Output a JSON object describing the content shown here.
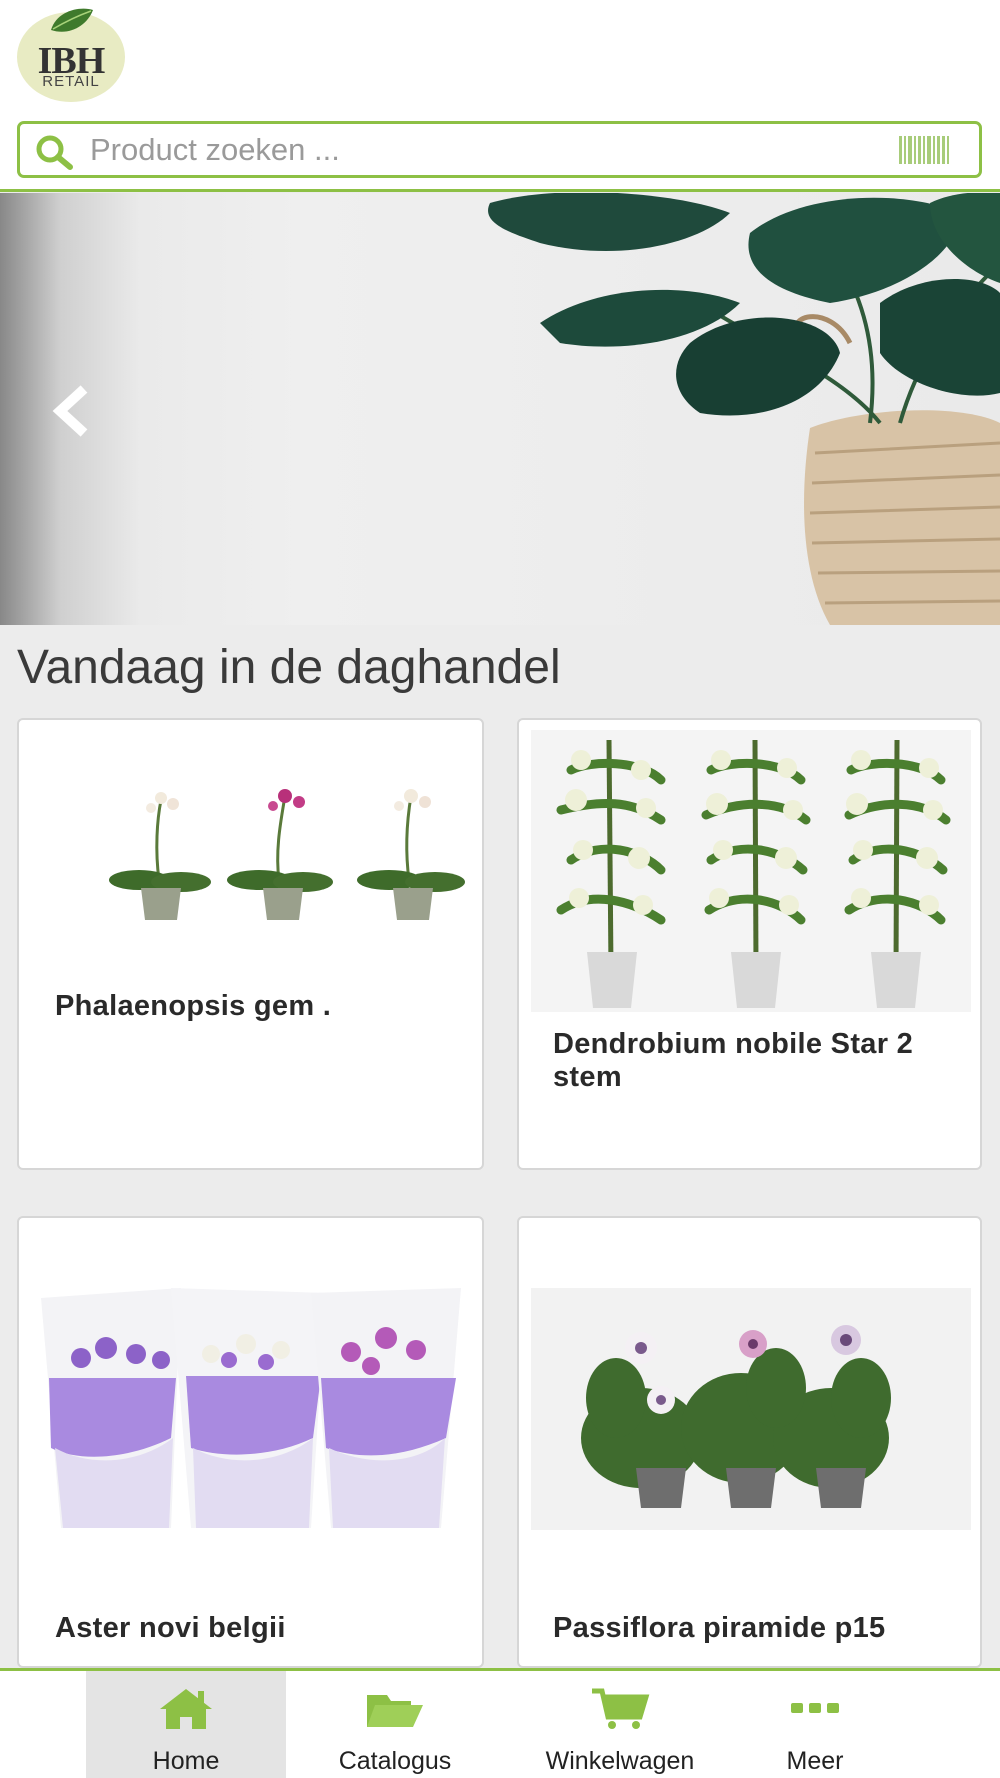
{
  "header": {
    "logo_text": "IBH",
    "logo_subtext": "RETAIL"
  },
  "search": {
    "placeholder": "Product zoeken ..."
  },
  "section": {
    "title": "Vandaag in de daghandel"
  },
  "products": [
    {
      "name": "Phalaenopsis gem ."
    },
    {
      "name": "Dendrobium nobile Star 2 stem"
    },
    {
      "name": "Aster novi belgii"
    },
    {
      "name": "Passiflora piramide p15"
    }
  ],
  "nav": {
    "items": [
      {
        "label": "Home",
        "icon": "home-icon"
      },
      {
        "label": "Catalogus",
        "icon": "folder-open-icon"
      },
      {
        "label": "Winkelwagen",
        "icon": "shopping-cart-icon"
      },
      {
        "label": "Meer",
        "icon": "ellipsis-icon"
      }
    ],
    "active": "Home"
  },
  "colors": {
    "accent": "#8dc045",
    "background": "#ececec"
  }
}
